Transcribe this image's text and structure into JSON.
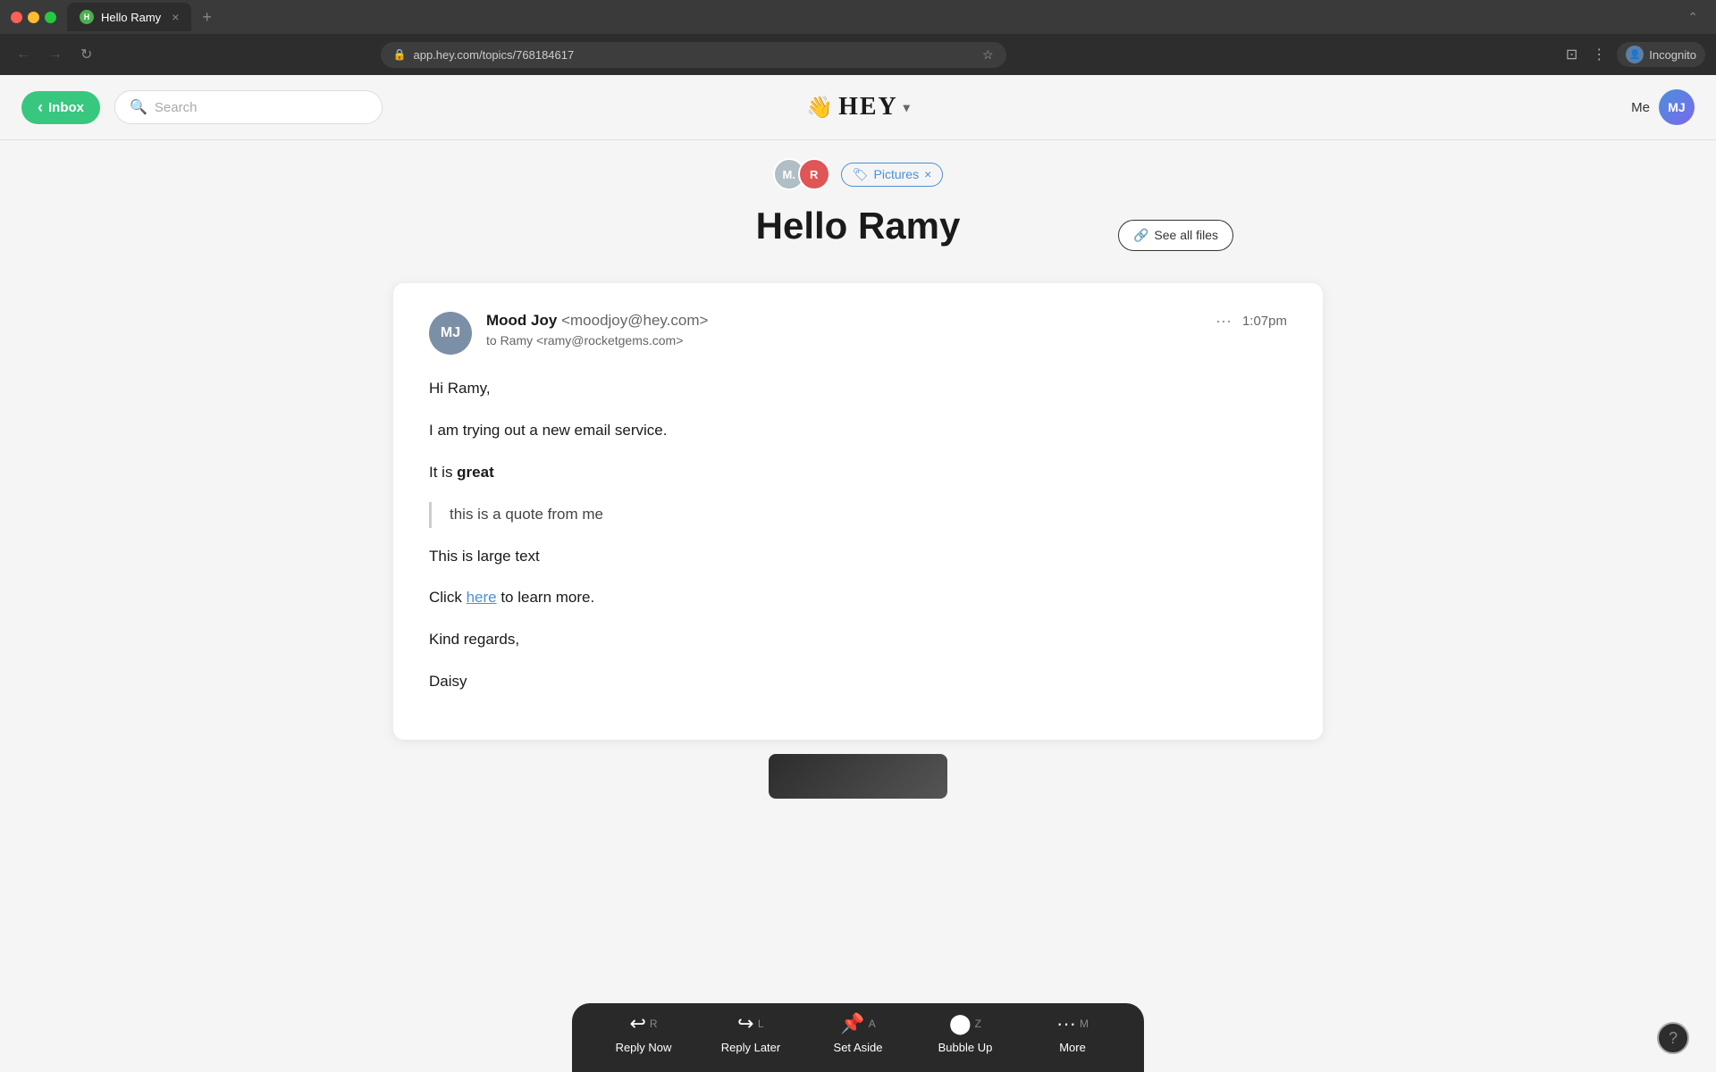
{
  "browser": {
    "tab_title": "Hello Ramy",
    "tab_close": "×",
    "tab_new": "+",
    "url": "app.hey.com/topics/768184617",
    "expand": "⌃",
    "nav_back": "←",
    "nav_forward": "→",
    "nav_refresh": "↻",
    "profile_name": "Incognito",
    "profile_icon": "👤",
    "bookmark": "☆",
    "menu": "⋮",
    "reader_mode": "⊡"
  },
  "app_header": {
    "inbox_label": "Inbox",
    "inbox_arrow": "‹",
    "search_placeholder": "Search",
    "logo_wave": "👋",
    "logo_text": "HEY",
    "logo_chevron": "▾",
    "user_name": "Me",
    "user_initials": "MJ"
  },
  "email_view": {
    "sender_initial_m": "M.",
    "sender_initial_r": "R",
    "tag_icon": "🏷",
    "tag_label": "Pictures",
    "tag_close": "×",
    "title": "Hello Ramy",
    "see_all_files_icon": "🔗",
    "see_all_files_label": "See all files"
  },
  "email_message": {
    "sender_initials": "MJ",
    "sender_name": "Mood Joy",
    "sender_email": "<moodjoy@hey.com>",
    "to_line": "to Ramy <ramy@rocketgems.com>",
    "more_dots": "···",
    "time": "1:07pm",
    "body_greeting": "Hi Ramy,",
    "body_line1": "I am trying out a new email service.",
    "body_line2_prefix": "It is ",
    "body_line2_bold": "great",
    "blockquote_text": "this is a quote from me",
    "body_line3": "This is large text",
    "body_line4_prefix": "Click ",
    "body_link": "here",
    "body_line4_suffix": " to learn more.",
    "body_closing": "Kind regards,",
    "body_signature": "Daisy"
  },
  "toolbar": {
    "reply_now_icon": "↩",
    "reply_now_key": "R",
    "reply_now_label": "Reply Now",
    "reply_later_icon": "↩",
    "reply_later_key": "L",
    "reply_later_label": "Reply Later",
    "set_aside_icon": "📌",
    "set_aside_key": "A",
    "set_aside_label": "Set Aside",
    "bubble_up_icon": "●",
    "bubble_up_key": "Z",
    "bubble_up_label": "Bubble Up",
    "more_icon": "···",
    "more_key": "M",
    "more_label": "More"
  },
  "help": {
    "label": "?"
  }
}
